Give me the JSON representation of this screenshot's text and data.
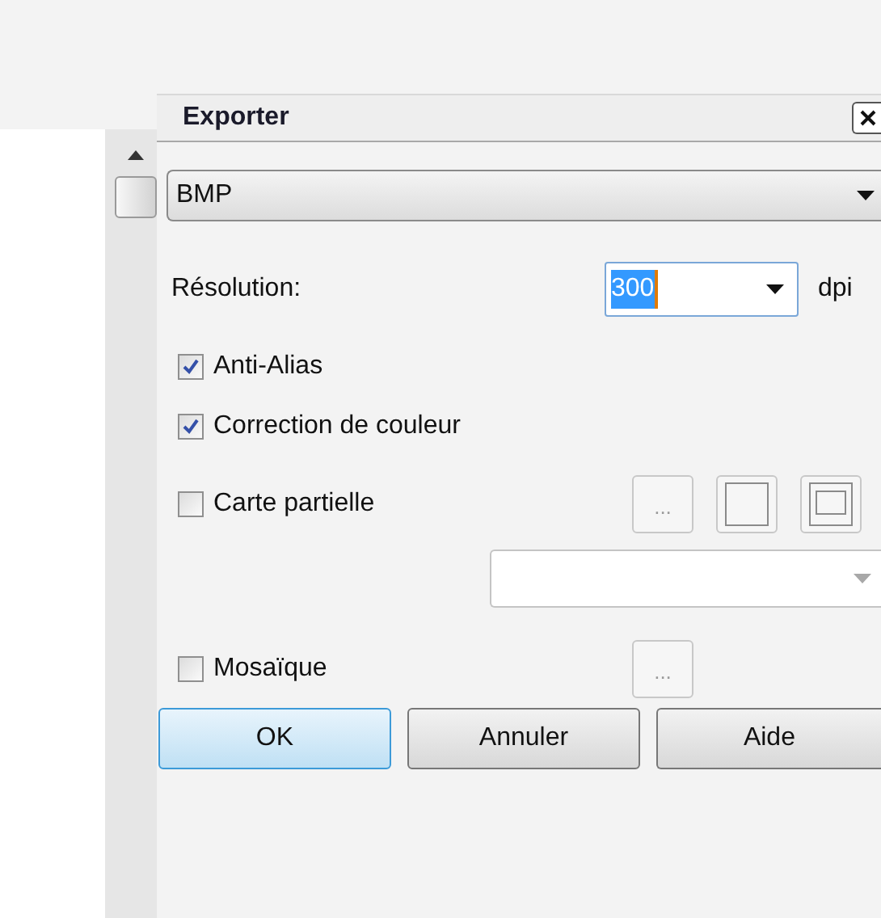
{
  "dialog": {
    "title": "Exporter"
  },
  "format": {
    "value": "BMP"
  },
  "resolution": {
    "label": "Résolution:",
    "value": "300",
    "unit": "dpi"
  },
  "options": [
    {
      "label": "Anti-Alias",
      "checked": true,
      "kind": "plain"
    },
    {
      "label": "Correction de couleur",
      "checked": true,
      "kind": "plain"
    },
    {
      "label": "Carte partielle",
      "checked": false,
      "kind": "map",
      "browse": "..."
    },
    {
      "label": "Mosaïque",
      "checked": false,
      "kind": "browse",
      "browse": "..."
    }
  ],
  "buttons": [
    {
      "label": "OK",
      "selected": true
    },
    {
      "label": "Annuler",
      "selected": false
    },
    {
      "label": "Aide",
      "selected": false
    }
  ]
}
